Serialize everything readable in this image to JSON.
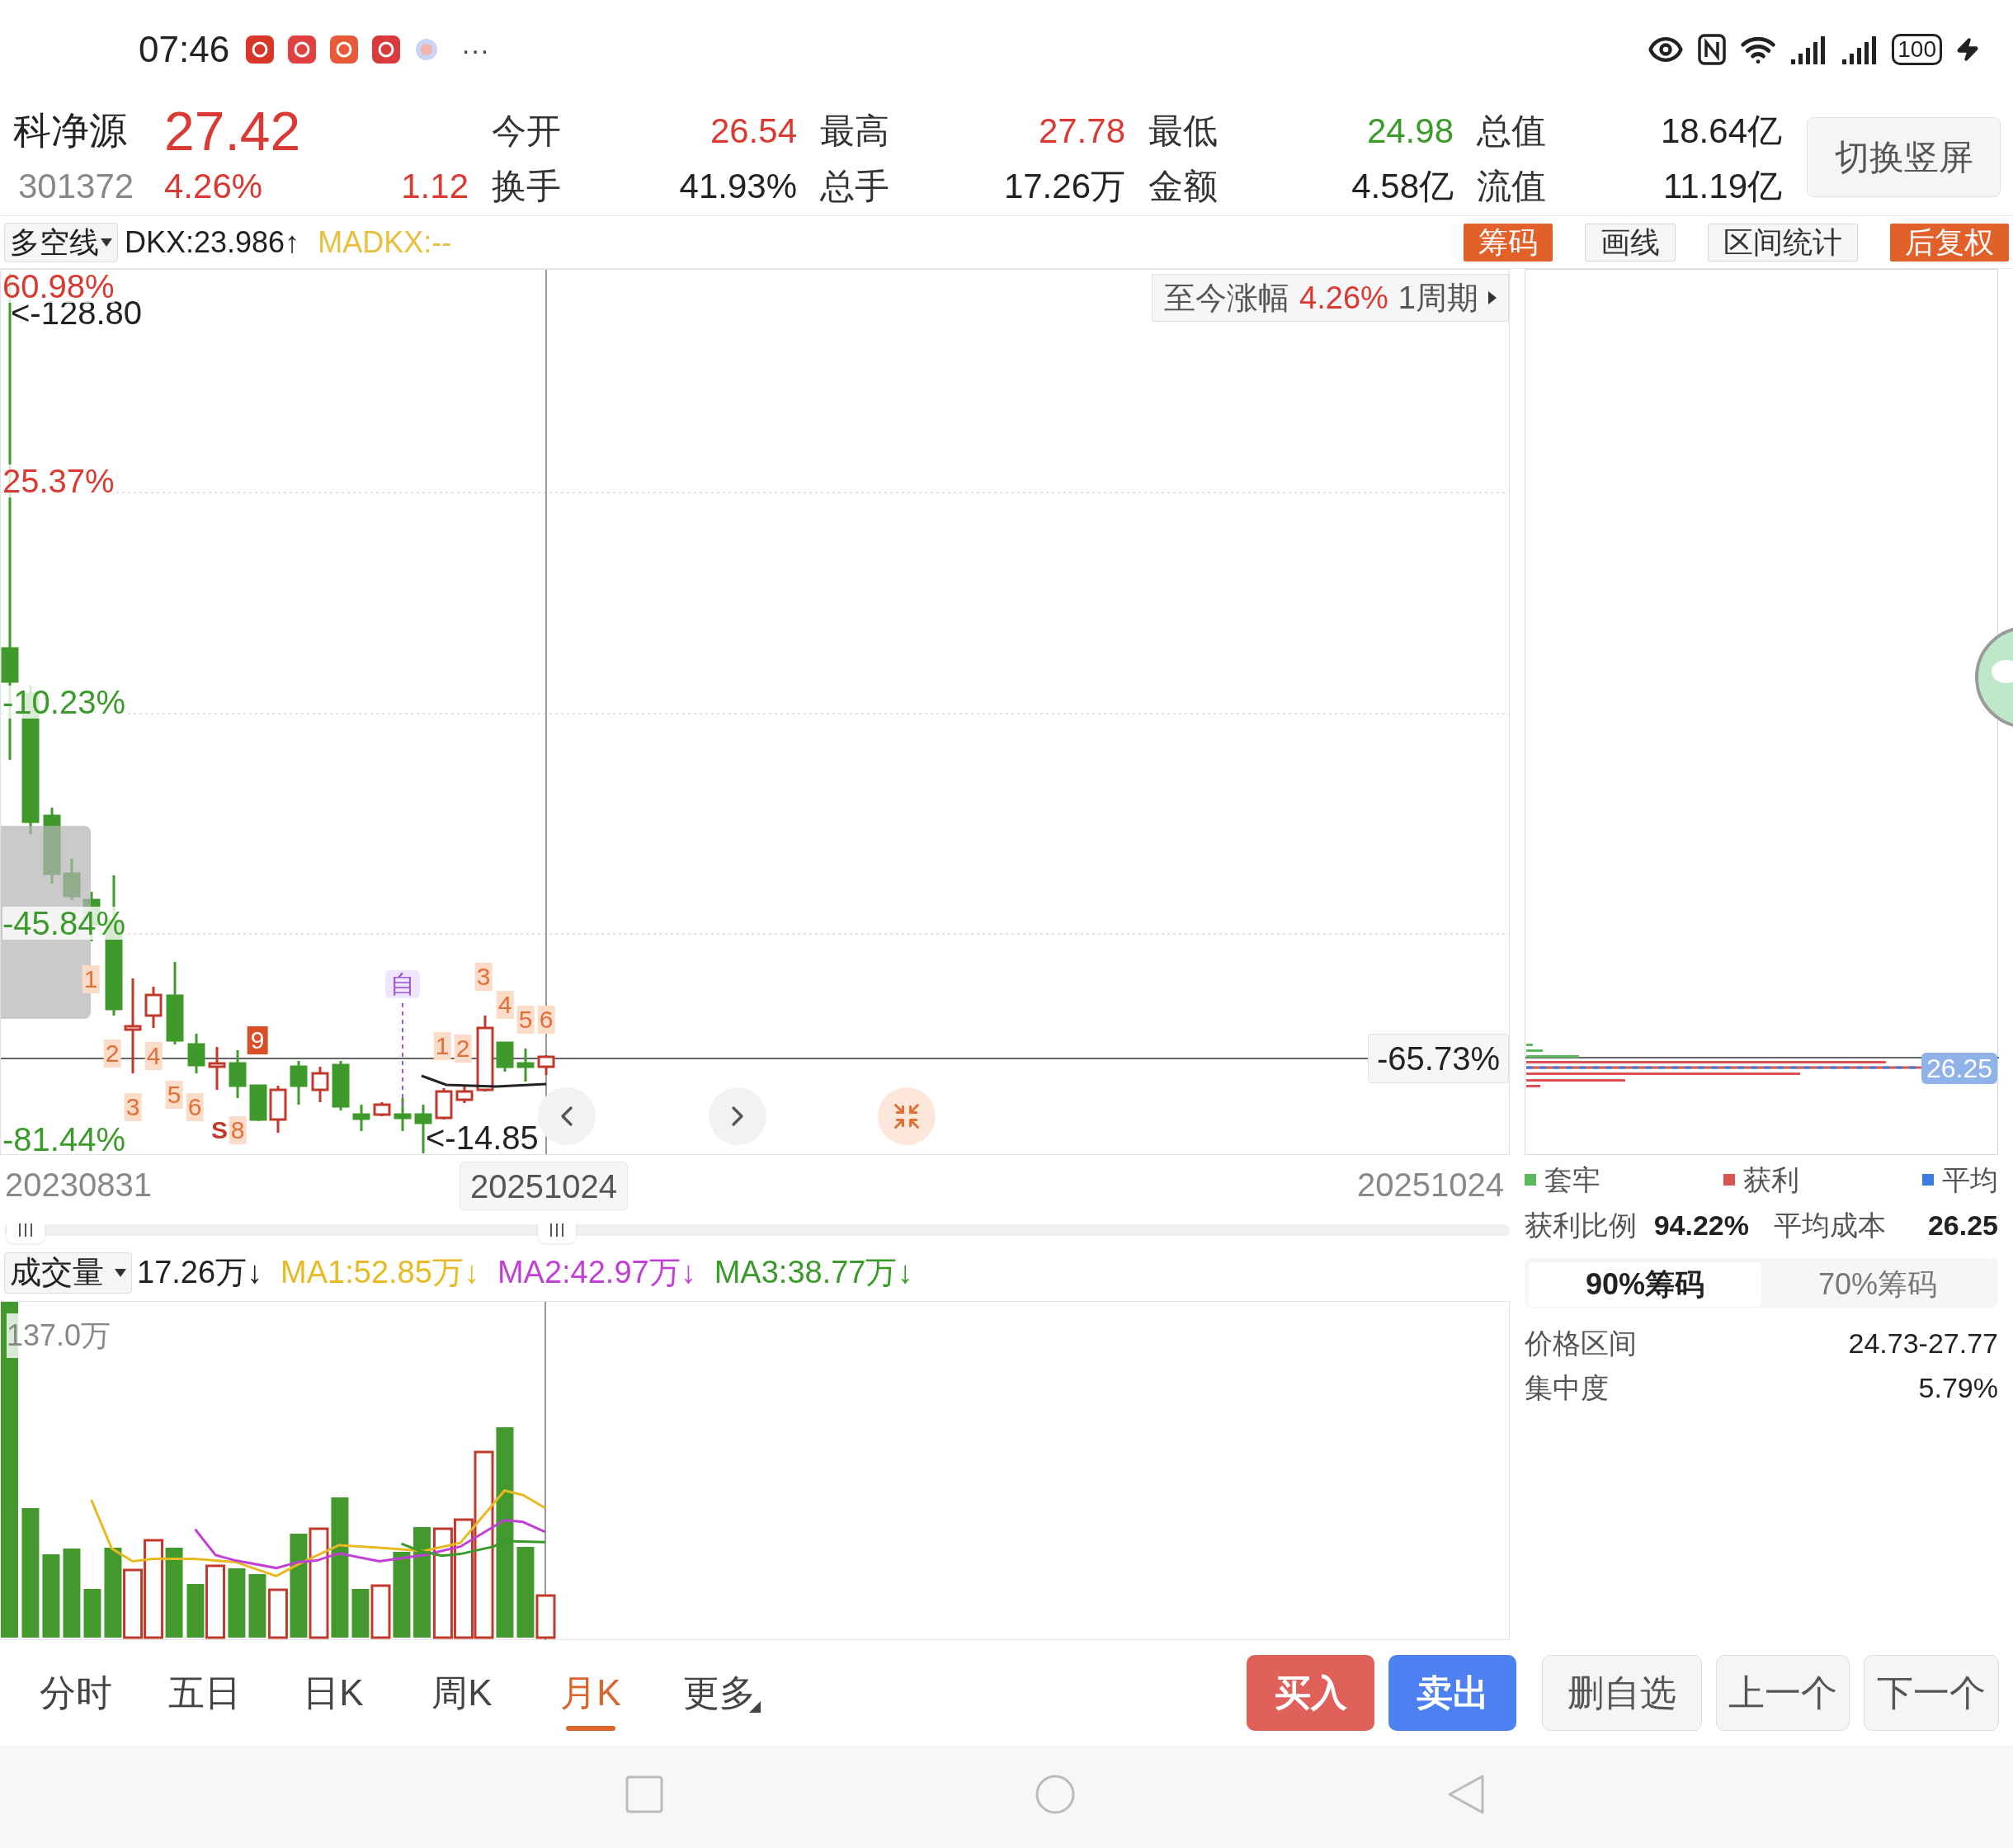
{
  "status_bar": {
    "time": "07:46",
    "more": "···",
    "battery": "100"
  },
  "quote": {
    "name": "科净源",
    "price": "27.42",
    "code": "301372",
    "change_pct": "4.26%",
    "change": "1.12",
    "color": "#d93a33"
  },
  "stats": [
    {
      "label": "今开",
      "value": "26.54",
      "color": "#d93a33"
    },
    {
      "label": "最高",
      "value": "27.78",
      "color": "#d93a33"
    },
    {
      "label": "最低",
      "value": "24.98",
      "color": "#3a9a2a"
    },
    {
      "label": "总值",
      "value": "18.64亿",
      "color": "#222222"
    },
    {
      "label": "换手",
      "value": "41.93%",
      "color": "#222222"
    },
    {
      "label": "总手",
      "value": "17.26万",
      "color": "#222222"
    },
    {
      "label": "金额",
      "value": "4.58亿",
      "color": "#222222"
    },
    {
      "label": "流值",
      "value": "11.19亿",
      "color": "#222222"
    }
  ],
  "orientation_button": "切换竖屏",
  "indicator": {
    "name": "多空线",
    "dkx": "DKX:23.986↑",
    "madkx": "MADKX:--"
  },
  "chart_tools": [
    {
      "label": "筹码",
      "selected": true
    },
    {
      "label": "画线",
      "selected": false
    },
    {
      "label": "区间统计",
      "selected": false
    },
    {
      "label": "后复权",
      "selected": true
    }
  ],
  "kline": {
    "axis_labels": [
      {
        "text": "60.98%",
        "color": "#d93a33"
      },
      {
        "text": "25.37%",
        "color": "#d93a33"
      },
      {
        "text": "-10.23%",
        "color": "#3a9a2a"
      },
      {
        "text": "-45.84%",
        "color": "#3a9a2a"
      },
      {
        "text": "-81.44%",
        "color": "#3a9a2a"
      }
    ],
    "high_marker": "<-128.80",
    "low_marker": "<-14.85",
    "change_badge": {
      "label": "至今涨幅",
      "value": "4.26%",
      "period": "1周期"
    },
    "crosshair_value": "-65.73%",
    "signals": [
      {
        "text": "1",
        "kind": "count"
      },
      {
        "text": "2",
        "kind": "count"
      },
      {
        "text": "4",
        "kind": "count"
      },
      {
        "text": "3",
        "kind": "count"
      },
      {
        "text": "5",
        "kind": "count"
      },
      {
        "text": "6",
        "kind": "count"
      },
      {
        "text": "S",
        "kind": "s"
      },
      {
        "text": "8",
        "kind": "count"
      },
      {
        "text": "9",
        "kind": "strong"
      },
      {
        "text": "自",
        "kind": "self"
      },
      {
        "text": "1",
        "kind": "count"
      },
      {
        "text": "2",
        "kind": "count"
      },
      {
        "text": "3",
        "kind": "count"
      },
      {
        "text": "4",
        "kind": "count"
      },
      {
        "text": "5",
        "kind": "count"
      },
      {
        "text": "6",
        "kind": "count"
      }
    ]
  },
  "dates": {
    "start": "20230831",
    "cursor": "20251024",
    "end": "20251024"
  },
  "volume": {
    "indicator": "成交量",
    "value": "17.26万↓",
    "ma": [
      {
        "text": "MA1:52.85万↓",
        "color": "#e8b923"
      },
      {
        "text": "MA2:42.97万↓",
        "color": "#c23fd6"
      },
      {
        "text": "MA3:38.77万↓",
        "color": "#3a9a2a"
      }
    ],
    "max_label": "137.0万"
  },
  "chips": {
    "price_tag": "26.25",
    "legend": [
      {
        "label": "套牢",
        "color": "#5cb85c"
      },
      {
        "label": "获利",
        "color": "#d9534f"
      },
      {
        "label": "平均",
        "color": "#3b7de0"
      }
    ],
    "stats": [
      {
        "label": "获利比例",
        "value": "94.22%"
      },
      {
        "label": "平均成本",
        "value": "26.25"
      }
    ],
    "ranges": [
      {
        "label": "90%筹码",
        "selected": true
      },
      {
        "label": "70%筹码",
        "selected": false
      }
    ],
    "details": [
      {
        "label": "价格区间",
        "value": "24.73-27.77"
      },
      {
        "label": "集中度",
        "value": "5.79%"
      }
    ]
  },
  "period_tabs": [
    {
      "label": "分时",
      "selected": false
    },
    {
      "label": "五日",
      "selected": false
    },
    {
      "label": "日K",
      "selected": false
    },
    {
      "label": "周K",
      "selected": false
    },
    {
      "label": "月K",
      "selected": true
    },
    {
      "label": "更多",
      "selected": false
    }
  ],
  "actions": [
    {
      "label": "买入",
      "kind": "buy"
    },
    {
      "label": "卖出",
      "kind": "sell"
    },
    {
      "label": "删自选",
      "kind": "plain"
    },
    {
      "label": "上一个",
      "kind": "plain"
    },
    {
      "label": "下一个",
      "kind": "plain"
    }
  ]
}
